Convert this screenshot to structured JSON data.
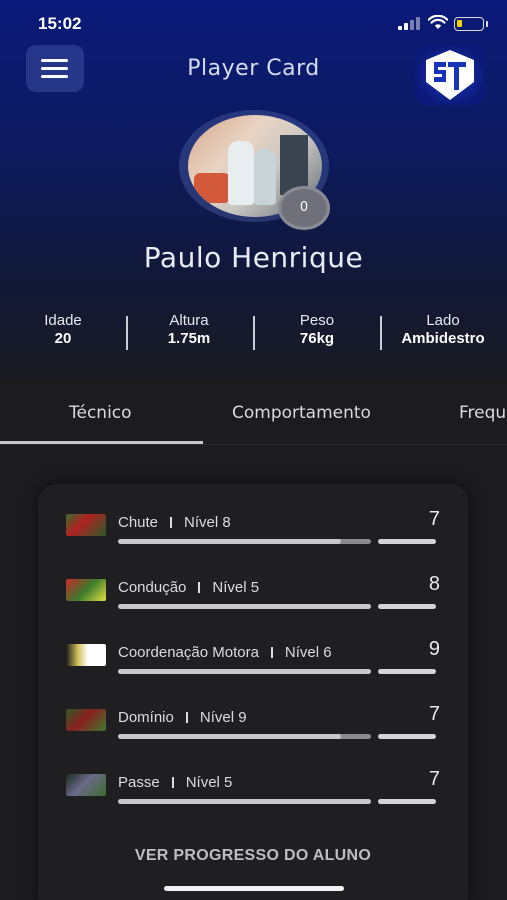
{
  "status_bar": {
    "time": "15:02",
    "battery_color": "#f2d200"
  },
  "header": {
    "title": "Player Card",
    "menu_icon": "hamburger-menu-icon",
    "logo": "stg-logo"
  },
  "profile": {
    "name": "Paulo Henrique",
    "badge_value": "0"
  },
  "stats": [
    {
      "label": "Idade",
      "value": "20"
    },
    {
      "label": "Altura",
      "value": "1.75m"
    },
    {
      "label": "Peso",
      "value": "76kg"
    },
    {
      "label": "Lado",
      "value": "Ambidestro"
    }
  ],
  "tabs": [
    {
      "label": "Técnico",
      "active": true
    },
    {
      "label": "Comportamento",
      "active": false
    },
    {
      "label": "Freque",
      "active": false
    }
  ],
  "skills": [
    {
      "name": "Chute",
      "level": "Nível 8",
      "score": "7",
      "progress": 0.88,
      "thumb": "soccer-action-photo"
    },
    {
      "name": "Condução",
      "level": "Nível 5",
      "score": "8",
      "progress": 1.0,
      "thumb": "soccer-action-photo"
    },
    {
      "name": "Coordenação Motora",
      "level": "Nível 6",
      "score": "9",
      "progress": 1.0,
      "thumb": "soccer-action-photo"
    },
    {
      "name": "Domínio",
      "level": "Nível 9",
      "score": "7",
      "progress": 0.88,
      "thumb": "soccer-action-photo"
    },
    {
      "name": "Passe",
      "level": "Nível 5",
      "score": "7",
      "progress": 1.0,
      "thumb": "soccer-action-photo"
    }
  ],
  "footer": {
    "progress_link": "VER PROGRESSO DO ALUNO"
  }
}
